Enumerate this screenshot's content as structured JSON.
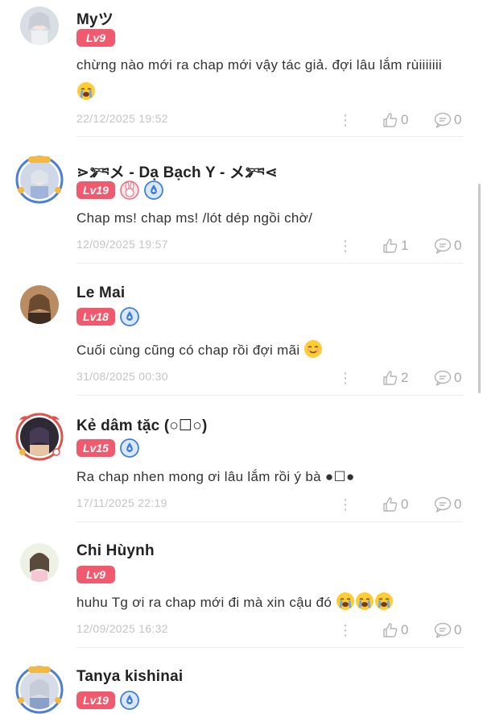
{
  "comments": [
    {
      "name": "Myツ",
      "level": "Lv9",
      "medals": [],
      "text": "chừng nào mới ra chap mới vậy tác giả. đợi lâu lắm rùiiiiiii",
      "text_emojis": [
        "crying-face"
      ],
      "date": "22/12/2025 19:52",
      "likes": "0",
      "replies": "0"
    },
    {
      "name": "⋗𓀒メ - Dạ Bạch Y - メ𓀒⋖",
      "level": "Lv19",
      "medals": [
        "rabbit-medal",
        "blue-drop-medal"
      ],
      "text": "Chap ms! chap ms! /lót dép ngồi chờ/",
      "text_emojis": [],
      "date": "12/09/2025 19:57",
      "likes": "1",
      "replies": "0"
    },
    {
      "name": "Le Mai",
      "level": "Lv18",
      "medals": [
        "blue-drop-medal"
      ],
      "text": "Cuối cùng cũng có chap rồi đợi mãi",
      "text_emojis": [
        "smiling-face"
      ],
      "date": "31/08/2025 00:30",
      "likes": "2",
      "replies": "0"
    },
    {
      "name": "Kẻ dâm tặc (○☐○)",
      "level": "Lv15",
      "medals": [
        "blue-drop-medal"
      ],
      "text": "Ra chap nhen mong ơi lâu lắm rồi ý bà ●☐●",
      "text_emojis": [],
      "date": "17/11/2025 22:19",
      "likes": "0",
      "replies": "0"
    },
    {
      "name": "Chi Hùynh",
      "level": "Lv9",
      "medals": [],
      "text": "huhu Tg ơi ra chap mới đi mà xin cậu đó",
      "text_emojis": [
        "crying-face",
        "crying-face",
        "crying-face"
      ],
      "date": "12/09/2025 16:32",
      "likes": "0",
      "replies": "0"
    },
    {
      "name": "Tanya kishinai",
      "level": "Lv19",
      "medals": [
        "blue-drop-medal"
      ],
      "text": "",
      "text_emojis": [],
      "date": "",
      "likes": "",
      "replies": ""
    }
  ],
  "colors": {
    "level_badge": "#f05a6e",
    "medal_blue": "#3d7fe0",
    "meta_text": "#c4c4c4",
    "icon_gray": "#b4b4b4"
  },
  "icons": {
    "like": "thumbs-up-icon",
    "reply": "comment-bubble-icon",
    "more": "more-vertical-icon"
  }
}
